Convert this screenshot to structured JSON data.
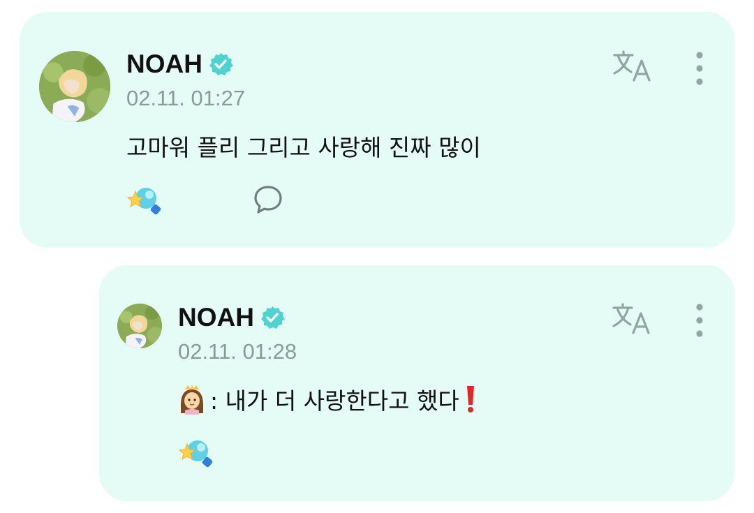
{
  "posts": [
    {
      "author": "NOAH",
      "timestamp": "02.11. 01:27",
      "text": "고마워 플리 그리고 사랑해 진짜 많이",
      "icons": [
        "avatar",
        "verified-badge-icon",
        "translate-icon",
        "more-vertical-icon",
        "star-light-reaction-icon",
        "comment-bubble-icon"
      ]
    },
    {
      "author": "NOAH",
      "timestamp": "02.11. 01:28",
      "text": ": 내가 더 사랑한다고 했다",
      "prefix_emoji": "princess-emoji",
      "suffix_emoji": "red-exclamation-emoji",
      "icons": [
        "avatar",
        "verified-badge-icon",
        "translate-icon",
        "more-vertical-icon",
        "star-light-reaction-icon"
      ]
    }
  ],
  "colors": {
    "card_background": "#e5fbf6",
    "badge": "#4fd3d0",
    "icon_gray": "#8fa6a3",
    "timestamp": "#8a9a98"
  }
}
